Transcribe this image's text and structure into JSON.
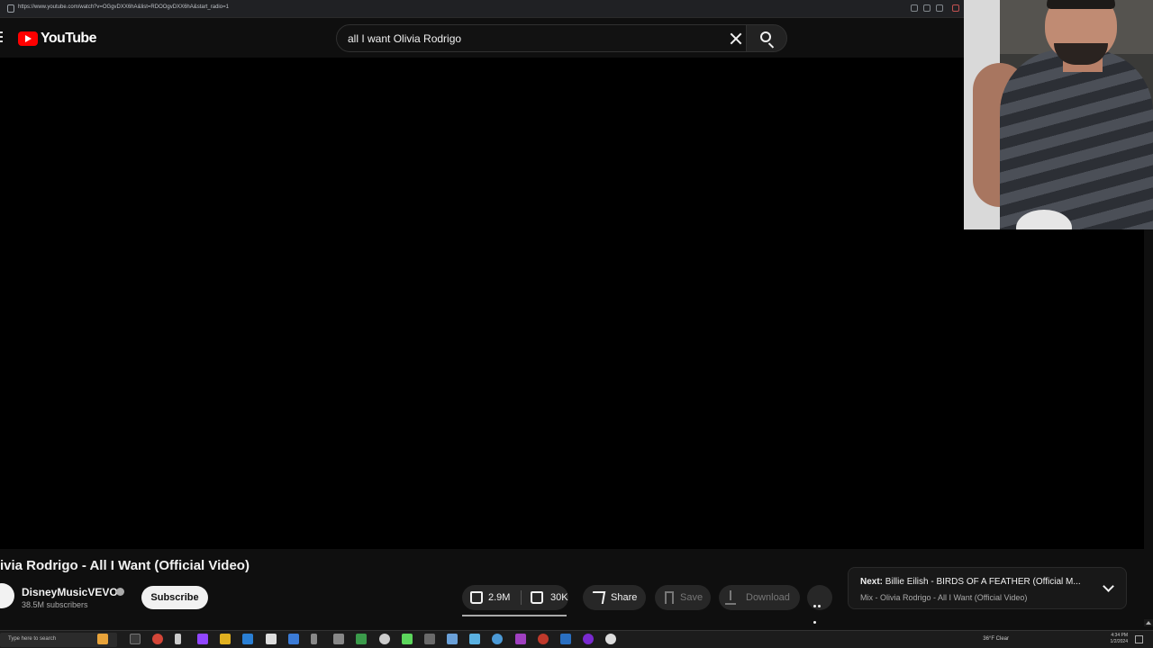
{
  "browser": {
    "url": "https://www.youtube.com/watch?v=OGgvDXX6hA&list=RDOOgvDXX6hA&start_radio=1"
  },
  "header": {
    "logo_text": "YouTube",
    "search_value": "all I want Olivia Rodrigo"
  },
  "video": {
    "title": "ivia Rodrigo - All I Want (Official Video)",
    "channel_name": "DisneyMusicVEVO",
    "subscribers": "38.5M subscribers",
    "subscribe_label": "Subscribe",
    "likes": "2.9M",
    "dislikes": "30K",
    "share_label": "Share",
    "save_label": "Save",
    "download_label": "Download"
  },
  "next_card": {
    "prefix": "Next:",
    "title": "Billie Eilish - BIRDS OF A FEATHER (Official M...",
    "subtitle": "Mix - Olivia Rodrigo - All I Want (Official Video)"
  },
  "taskbar": {
    "search_placeholder": "Type here to search",
    "weather": "36°F  Clear",
    "time": "4:34 PM",
    "date": "1/2/2024"
  },
  "colors": {
    "background": "#0f0f0f",
    "brand_red": "#ff0000",
    "subscribe_bg": "#f1f1f1"
  }
}
